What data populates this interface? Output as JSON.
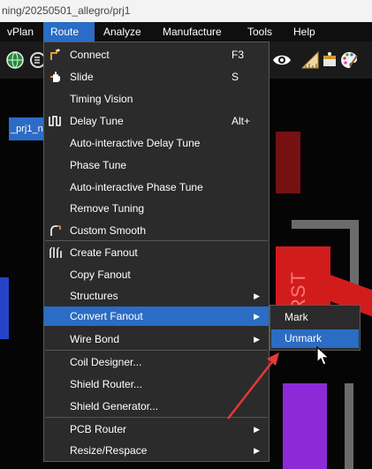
{
  "window": {
    "title": "ning/20250501_allegro/prj1"
  },
  "menubar": {
    "items": [
      "vPlan",
      "Route",
      "Analyze",
      "Manufacture",
      "Tools",
      "Help"
    ],
    "active": "Route"
  },
  "doc_tab": {
    "label": "_prj1_n"
  },
  "canvas": {
    "rst_label": "RST"
  },
  "route_menu": {
    "items": [
      {
        "label": "Connect",
        "shortcut": "F3"
      },
      {
        "label": "Slide",
        "shortcut": "S"
      },
      {
        "label": "Timing Vision",
        "shortcut": ""
      },
      {
        "label": "Delay Tune",
        "shortcut": "Alt+"
      },
      {
        "label": "Auto-interactive Delay Tune",
        "shortcut": ""
      },
      {
        "label": "Phase Tune",
        "shortcut": ""
      },
      {
        "label": "Auto-interactive Phase Tune",
        "shortcut": ""
      },
      {
        "label": "Remove Tuning",
        "shortcut": ""
      },
      {
        "label": "Custom Smooth",
        "shortcut": ""
      },
      {
        "label": "Create Fanout",
        "shortcut": ""
      },
      {
        "label": "Copy Fanout",
        "shortcut": ""
      },
      {
        "label": "Structures",
        "shortcut": ""
      },
      {
        "label": "Convert Fanout",
        "shortcut": ""
      },
      {
        "label": "Wire Bond",
        "shortcut": ""
      },
      {
        "label": "Coil Designer...",
        "shortcut": ""
      },
      {
        "label": "Shield Router...",
        "shortcut": ""
      },
      {
        "label": "Shield Generator...",
        "shortcut": ""
      },
      {
        "label": "PCB Router",
        "shortcut": ""
      },
      {
        "label": "Resize/Respace",
        "shortcut": ""
      }
    ]
  },
  "convert_fanout_submenu": {
    "items": [
      "Mark",
      "Unmark"
    ],
    "highlighted": "Unmark"
  },
  "colors": {
    "menu_bg": "#2b2b2b",
    "highlight": "#2b6cc4",
    "annotation_arrow": "#e53935"
  }
}
